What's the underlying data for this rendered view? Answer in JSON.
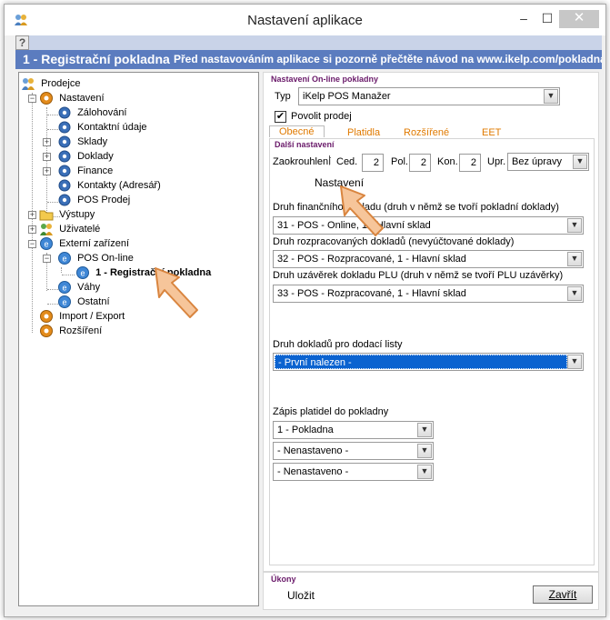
{
  "window": {
    "title": "Nastavení aplikace",
    "minimize_symbol": "–",
    "maximize_symbol": "☐",
    "close_symbol": "✕"
  },
  "help": {
    "symbol": "?"
  },
  "header": {
    "title": "1 - Registrační pokladna",
    "hint": "Před nastavováním aplikace si pozorně přečtěte návod na www.ikelp.com/pokladna"
  },
  "tree": {
    "items": [
      {
        "label": "Prodejce",
        "icon": "users-icon"
      },
      {
        "label": "Nastavení",
        "icon": "gear-icon"
      },
      {
        "label": "Zálohování",
        "icon": "small-gear-icon"
      },
      {
        "label": "Kontaktní údaje",
        "icon": "small-gear-icon"
      },
      {
        "label": "Sklady",
        "icon": "small-gear-icon"
      },
      {
        "label": "Doklady",
        "icon": "small-gear-icon"
      },
      {
        "label": "Finance",
        "icon": "small-gear-icon"
      },
      {
        "label": "Kontakty (Adresář)",
        "icon": "small-gear-icon"
      },
      {
        "label": "POS Prodej",
        "icon": "small-gear-icon"
      },
      {
        "label": "Výstupy",
        "icon": "folder-icon"
      },
      {
        "label": "Uživatelé",
        "icon": "users-icon"
      },
      {
        "label": "Externí zařízení",
        "icon": "device-icon"
      },
      {
        "label": "POS On-line",
        "icon": "device-icon"
      },
      {
        "label": "1 - Registrační pokladna",
        "icon": "device-icon"
      },
      {
        "label": "Váhy",
        "icon": "device-icon"
      },
      {
        "label": "Ostatní",
        "icon": "device-icon"
      },
      {
        "label": "Import / Export",
        "icon": "gear-icon"
      },
      {
        "label": "Rozšíření",
        "icon": "gear-icon"
      }
    ]
  },
  "online_section": {
    "label": "Nastavení On-line pokladny",
    "type_label": "Typ",
    "type_value": "iKelp POS Manažer",
    "allow_sale_label": "Povolit prodej",
    "allow_sale_checked": "✔"
  },
  "tabs": [
    "Obecné",
    "Platidla",
    "Rozšířené",
    "EET"
  ],
  "more_settings": {
    "label": "Další nastavení",
    "rounding_label": "Zaokrouhlení",
    "ced_label": "Ced.",
    "ced_value": "2",
    "pol_label": "Pol.",
    "pol_value": "2",
    "kon_label": "Kon.",
    "kon_value": "2",
    "upr_label": "Upr.",
    "upr_value": "Bez úpravy",
    "nastaveni_button": "Nastavení",
    "fin_doc_label": "Druh finančního dokladu (druh v němž se tvoří pokladní doklady)",
    "fin_doc_value": "31 - POS - Online, 1 - Hlavní sklad",
    "open_doc_label": "Druh rozpracovaných dokladů (nevyúčtované doklady)",
    "open_doc_value": "32 - POS - Rozpracované, 1 - Hlavní sklad",
    "plu_label": "Druh uzávěrek dokladu PLU (druh v němž se tvoří PLU uzávěrky)",
    "plu_value": "33 - POS - Rozpracované, 1 - Hlavní sklad",
    "delivery_label": "Druh dokladů pro dodací listy",
    "delivery_value": "- První nalezen -",
    "payment_label": "Zápis platidel do pokladny",
    "payment_values": [
      "1 - Pokladna",
      "- Nenastaveno -",
      "- Nenastaveno -"
    ]
  },
  "actions": {
    "label": "Úkony",
    "save": "Uložit",
    "close": "Zavřít"
  },
  "colors": {
    "header_bg": "#5b7cbf",
    "section_label": "#6a1a6a",
    "tab_text": "#e07a00",
    "selection": "#0b63d0"
  }
}
